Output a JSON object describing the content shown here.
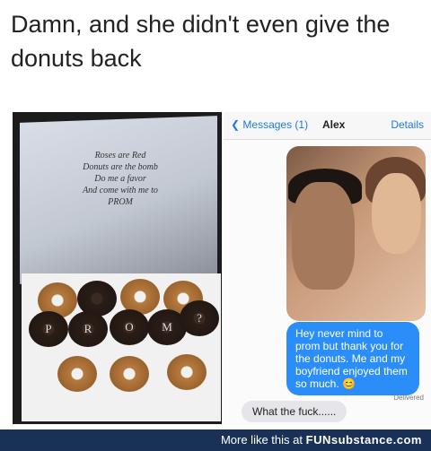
{
  "caption": "Damn, and she didn't even give the donuts back",
  "photo": {
    "poem": "Roses are Red\nDonuts are the bomb\nDo me a favor\nAnd come with me to\nPROM",
    "donut_letters": [
      "P",
      "R",
      "O",
      "M",
      "?"
    ]
  },
  "chat": {
    "back_label": "Messages (1)",
    "contact_name": "Alex",
    "details_label": "Details",
    "sent_message": "Hey never mind to prom but thank you for the donuts. Me and my boyfriend enjoyed them so much. 😊",
    "delivered_label": "Delivered",
    "received_message": "What the fuck......"
  },
  "footer": {
    "more_text": "More like this at",
    "brand": "FUNsubstance.com"
  },
  "colors": {
    "bubble_blue": "#2b8ef8",
    "ios_link_blue": "#1f7ae0",
    "footer_bg": "#1a3157"
  }
}
